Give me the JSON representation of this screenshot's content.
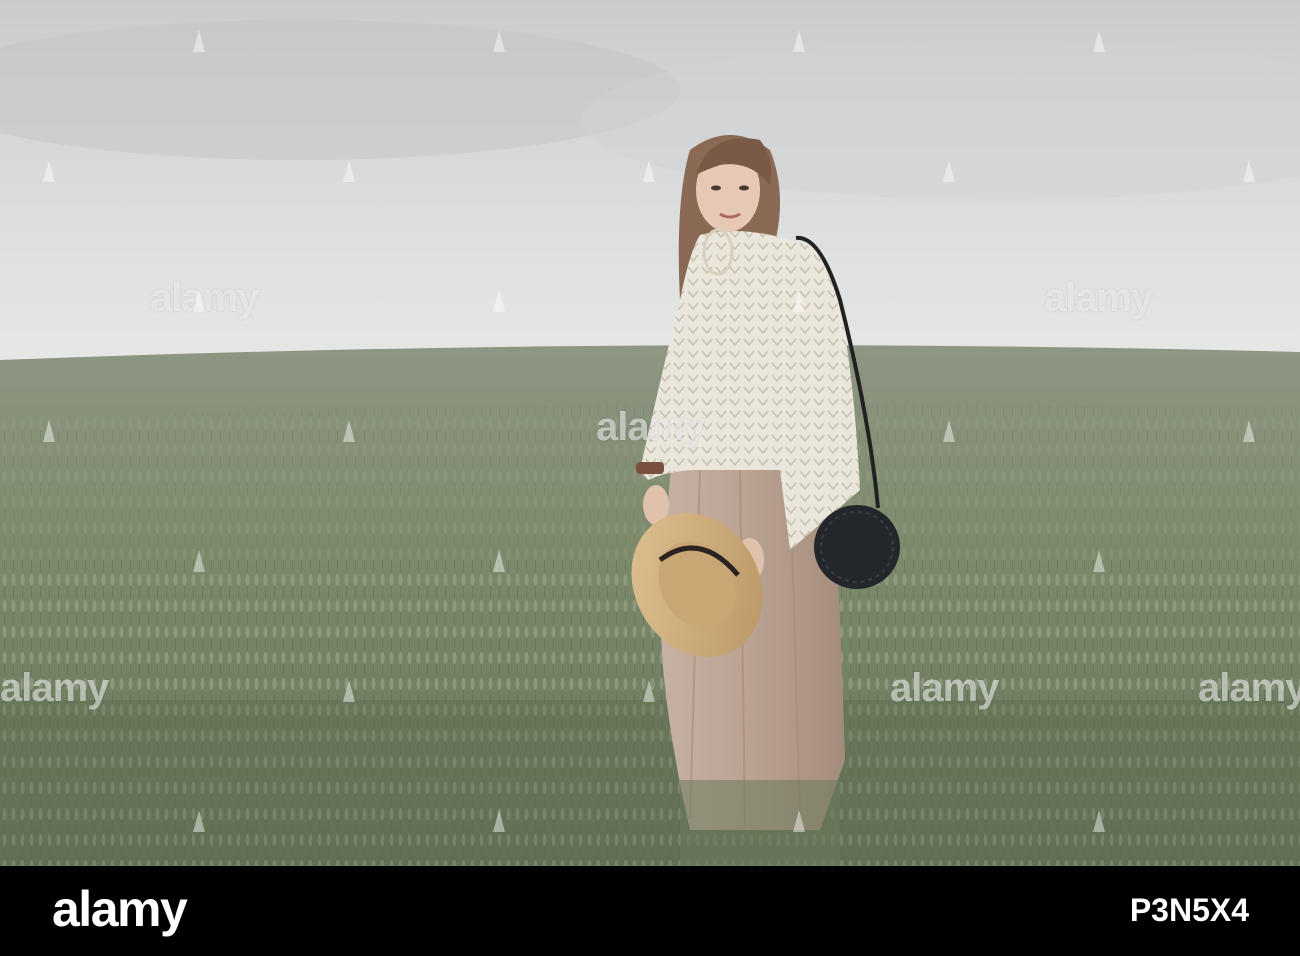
{
  "watermark": {
    "text": "alamy"
  },
  "footer": {
    "logo": "alamy",
    "image_id": "P3N5X4"
  },
  "colors": {
    "sky": "#d6d8da",
    "field": "#7f8c70",
    "footer_bg": "#000000",
    "footer_text": "#ffffff"
  },
  "scene": {
    "subject": "woman",
    "props": [
      "straw-hat",
      "black-round-bag"
    ]
  }
}
